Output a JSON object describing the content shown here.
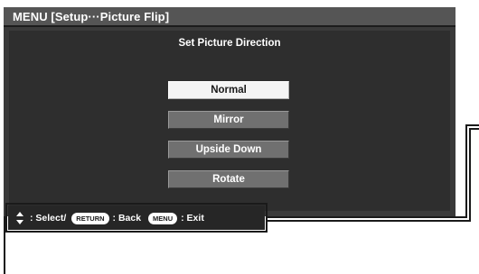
{
  "menu": {
    "title": "MENU  [Setup···Picture Flip]",
    "heading": "Set Picture Direction",
    "options": [
      {
        "label": "Normal",
        "selected": true
      },
      {
        "label": "Mirror",
        "selected": false
      },
      {
        "label": "Upside Down",
        "selected": false
      },
      {
        "label": "Rotate",
        "selected": false
      }
    ]
  },
  "navigation": {
    "select_label": ": Select/",
    "return_key": "RETURN",
    "back_label": ": Back",
    "menu_key": "MENU",
    "exit_label": ": Exit",
    "updown_icon": "up-down-arrows-icon"
  },
  "colors": {
    "menu_background": "#3a3a3a",
    "title_bar": "#555555",
    "selected_option": "#f4f4f4",
    "unselected_option": "#707070",
    "nav_bar": "#262626"
  }
}
